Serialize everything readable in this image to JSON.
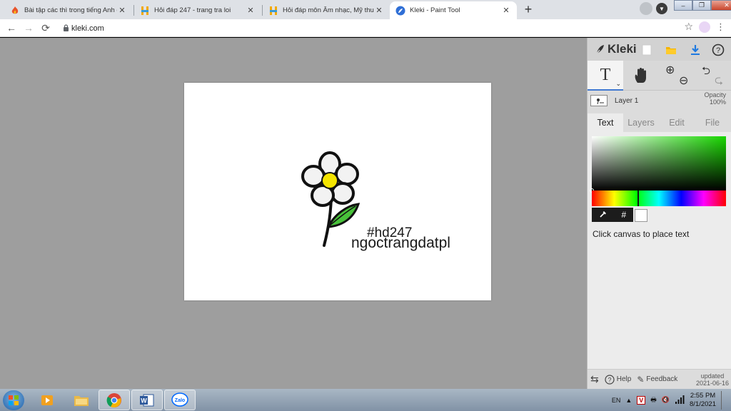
{
  "browser": {
    "tabs": [
      {
        "title": "Bài tập các thì trong tiếng Anh có",
        "active": false
      },
      {
        "title": "Hỏi đáp 247 - trang tra loi",
        "active": false
      },
      {
        "title": "Hỏi đáp môn Âm nhạc, Mỹ thuật",
        "active": false
      },
      {
        "title": "Kleki - Paint Tool",
        "active": true
      }
    ],
    "close_glyph": "✕",
    "new_tab_glyph": "+",
    "url": "kleki.com"
  },
  "canvas": {
    "text_line_1": "#hd247",
    "text_line_2": "ngoctrangdatpl",
    "flower_center_color": "#f4e400",
    "leaf_color": "#48c23a"
  },
  "panel": {
    "brand": "Kleki",
    "layer": {
      "name": "Layer 1",
      "opacity_label": "Opacity",
      "opacity_value": "100%"
    },
    "tabs": [
      {
        "label": "Text",
        "active": true
      },
      {
        "label": "Layers",
        "active": false
      },
      {
        "label": "Edit",
        "active": false
      },
      {
        "label": "File",
        "active": false
      }
    ],
    "hint": "Click canvas to place text",
    "hash_glyph": "#",
    "footer": {
      "help": "Help",
      "feedback": "Feedback",
      "updated_label": "updated",
      "updated_date": "2021-06-16"
    }
  },
  "taskbar": {
    "language": "EN",
    "time": "2:55 PM",
    "date": "8/1/2021"
  }
}
